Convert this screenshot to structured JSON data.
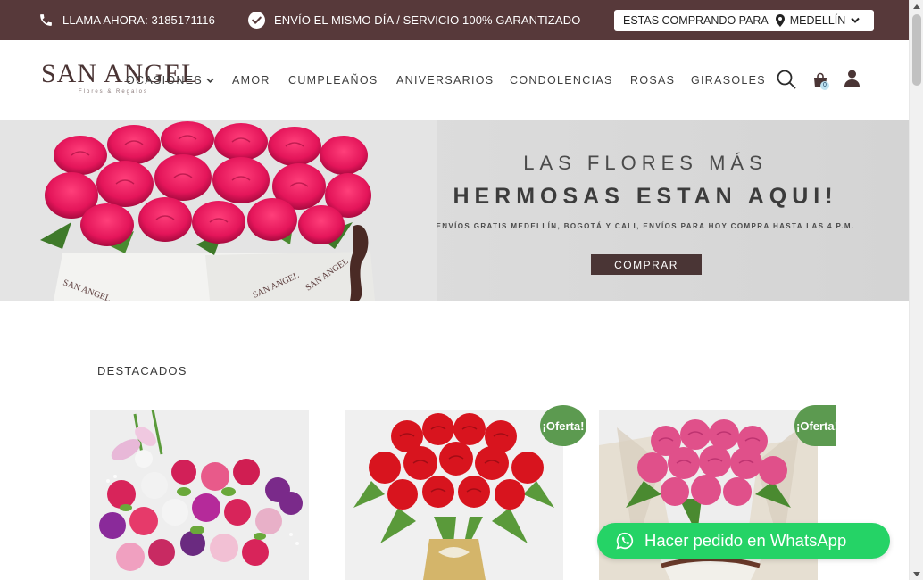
{
  "topbar": {
    "phone_label": "LLAMA AHORA: 3185171116",
    "shipping_label": "ENVÍO EL MISMO DÍA / SERVICIO 100% GARANTIZADO",
    "city_prefix": "ESTAS COMPRANDO PARA",
    "city_value": "MEDELLÍN"
  },
  "header": {
    "logo_main": "SAN ANGEL",
    "logo_sub": "Flores & Regalos",
    "nav": [
      {
        "label": "OCASIONES"
      },
      {
        "label": "AMOR"
      },
      {
        "label": "CUMPLEAÑOS"
      },
      {
        "label": "ANIVERSARIOS"
      },
      {
        "label": "CONDOLENCIAS"
      },
      {
        "label": "ROSAS"
      },
      {
        "label": "GIRASOLES"
      }
    ],
    "cart_count": "0"
  },
  "banner": {
    "line1": "LAS FLORES MÁS",
    "line2": "HERMOSAS ESTAN AQUI!",
    "line3": "ENVÍOS GRATIS MEDELLÍN, BOGOTÁ Y CALI, ENVÍOS PARA HOY COMPRA HASTA LAS 4 P.M.",
    "button": "COMPRAR"
  },
  "products": {
    "section_title": "DESTACADOS",
    "items": [
      {
        "badge": ""
      },
      {
        "badge": "¡Oferta!"
      },
      {
        "badge": "¡Oferta!"
      }
    ]
  },
  "whatsapp": {
    "label": "Hacer pedido en WhatsApp"
  },
  "colors": {
    "topbar": "#57393a",
    "button": "#4a3535",
    "badge": "#5c9a50",
    "whatsapp": "#25d366"
  }
}
